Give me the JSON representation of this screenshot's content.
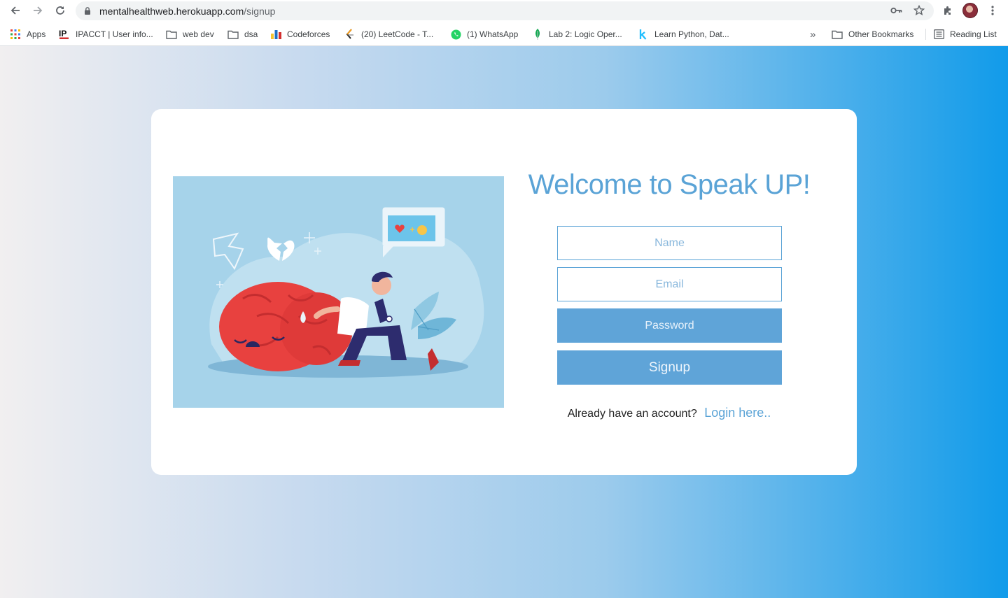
{
  "browser": {
    "url_host": "mentalhealthweb.herokuapp.com",
    "url_path": "/signup",
    "bookmarks": [
      {
        "label": "Apps",
        "icon": "apps-grid-icon"
      },
      {
        "label": "IPACCT | User info...",
        "icon": "ipacct-logo-icon"
      },
      {
        "label": "web dev",
        "icon": "folder-icon"
      },
      {
        "label": "dsa",
        "icon": "folder-icon"
      },
      {
        "label": "Codeforces",
        "icon": "codeforces-icon"
      },
      {
        "label": "(20) LeetCode - T...",
        "icon": "leetcode-icon"
      },
      {
        "label": "(1) WhatsApp",
        "icon": "whatsapp-icon"
      },
      {
        "label": "Lab 2: Logic Oper...",
        "icon": "mongodb-leaf-icon"
      },
      {
        "label": "Learn Python, Dat...",
        "icon": "kaggle-k-icon"
      }
    ],
    "overflow_label": "»",
    "other_bookmarks": "Other Bookmarks",
    "reading_list": "Reading List"
  },
  "signup": {
    "title": "Welcome to Speak UP!",
    "name_placeholder": "Name",
    "email_placeholder": "Email",
    "password_placeholder": "Password",
    "button_label": "Signup",
    "already_text": "Already have an account?",
    "login_link": "Login here.."
  },
  "colors": {
    "accent": "#5aa3d6",
    "gradient_start": "#f1eff0",
    "gradient_end": "#119bea",
    "illustration_bg": "#a6d3ea",
    "brain": "#e8413f"
  }
}
